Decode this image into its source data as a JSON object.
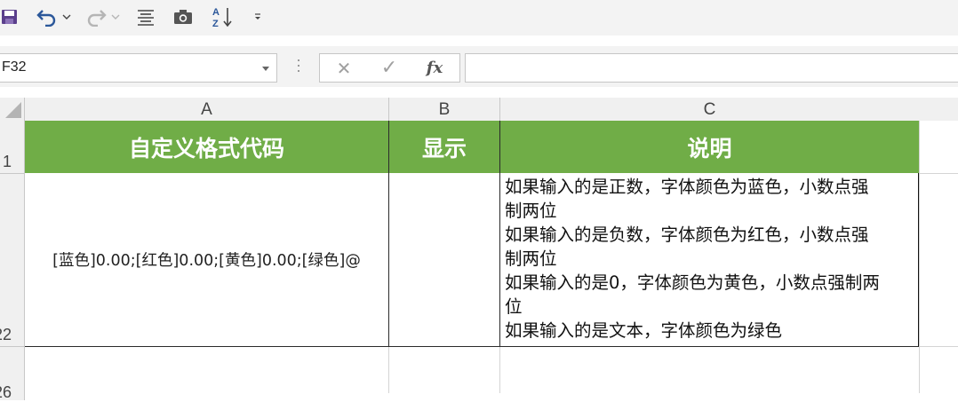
{
  "toolbar": {
    "icons": [
      "save-icon",
      "undo-icon",
      "dropdown-icon",
      "redo-icon",
      "dropdown-icon",
      "align-icon",
      "camera-icon",
      "sort-az-icon",
      "customize-icon"
    ]
  },
  "formula_bar": {
    "name_box": "F32",
    "cancel_glyph": "✕",
    "enter_glyph": "✓",
    "fx_label": "fx",
    "formula": ""
  },
  "columns": [
    "A",
    "B",
    "C"
  ],
  "rows": {
    "r1": "1",
    "r2": "22",
    "r3": "26"
  },
  "table": {
    "header": {
      "a": "自定义格式代码",
      "b": "显示",
      "c": "说明"
    },
    "code": "[蓝色]0.00;[红色]0.00;[黄色]0.00;[绿色]@",
    "display": "",
    "description_lines": [
      "如果输入的是正数，字体颜色为蓝色，小数点强",
      "制两位",
      "如果输入的是负数，字体颜色为红色，小数点强",
      "制两位",
      "如果输入的是0，字体颜色为黄色，小数点强制两",
      "位",
      "如果输入的是文本，字体颜色为绿色"
    ]
  },
  "colors": {
    "header_fill": "#70ad47",
    "header_text": "#ffffff",
    "accent_blue": "#2b579a"
  }
}
